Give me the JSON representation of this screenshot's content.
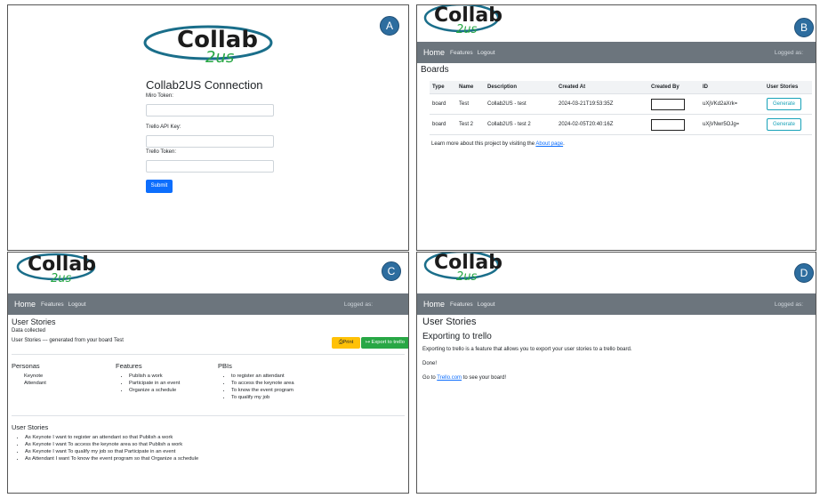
{
  "badges": {
    "a": "A",
    "b": "B",
    "c": "C",
    "d": "D"
  },
  "logo": {
    "main": "Collab",
    "sub": "2us"
  },
  "nav": {
    "home": "Home",
    "features": "Features",
    "logout": "Logout",
    "logged": "Logged as:"
  },
  "connection": {
    "title": "Collab2US Connection",
    "miro_label": "Miro Token:",
    "trello_api_label": "Trello API Key:",
    "trello_token_label": "Trello Token:",
    "submit": "Submit"
  },
  "boards": {
    "title": "Boards",
    "headers": [
      "Type",
      "Name",
      "Description",
      "Created At",
      "Created By",
      "ID",
      "User Stories"
    ],
    "rows": [
      {
        "type": "board",
        "name": "Test",
        "description": "Collab2US - test",
        "created_at": "2024-03-21T19:53:35Z",
        "id": "uXjVKd2aXrk=",
        "action": "Generate"
      },
      {
        "type": "board",
        "name": "Test 2",
        "description": "Collab2US - test 2",
        "created_at": "2024-02-05T20:40:16Z",
        "id": "uXjVNwr5OJg=",
        "action": "Generate"
      }
    ],
    "footer_text": "Learn more about this project by visiting the",
    "footer_link": "About page",
    "footer_end": "."
  },
  "stories": {
    "title": "User Stories",
    "subtitle": "Data collected",
    "generated": "User Stories --- generated from your board Test",
    "print": "Print",
    "export": "Export to trello",
    "personas_title": "Personas",
    "personas": [
      "Keynote",
      "Attendant"
    ],
    "features_title": "Features",
    "features": [
      "Publish a work",
      "Participate in an event",
      "Organize a schedule"
    ],
    "pbis_title": "PBIs",
    "pbis": [
      "to register an attendant",
      "To access the keynote area",
      "To know the event program",
      "To qualify my job"
    ],
    "list_title": "User Stories",
    "list": [
      "As Keynote I want to register an attendant so that Publish a work",
      "As Keynote I want To access the keynote area so that Publish a work",
      "As Keynote I want To qualify my job so that Participate in an event",
      "As Attendant I want To know the event program so that Organize a schedule"
    ]
  },
  "export": {
    "title": "User Stories",
    "subtitle": "Exporting to trello",
    "desc": "Exporting to trello is a feature that allows you to export your user stories to a trello board.",
    "done": "Done!",
    "goto_pre": "Go to",
    "goto_link": "Trello.com",
    "goto_post": "to see your board!"
  }
}
